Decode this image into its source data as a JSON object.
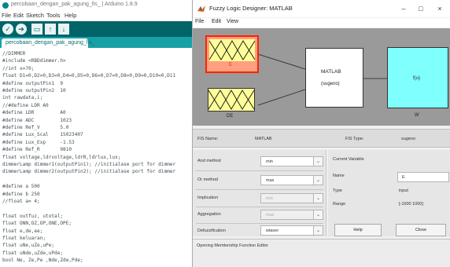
{
  "arduino": {
    "title": "percobaan_dengan_pak_agung_fis_ | Arduino 1.8.9",
    "menu": [
      "File",
      "Edit",
      "Sketch",
      "Tools",
      "Help"
    ],
    "tab": "percobaan_dengan_pak_agung_fis_",
    "code": [
      "//DIMMER",
      "#include <RBDdimmer.h>",
      "//int x=70;",
      "float D1=0,D2=0,D3=0,D4=0,D5=0,D6=0,D7=0,D8=0,D9=0,D10=0,D11",
      "#define outputPin1  9",
      "#define outputPin2  10",
      "int rawdata,i;",
      "//#define LDR A0",
      "#define LDR         A0",
      "#define ADC         1023",
      "#define Ref_V       5.0",
      "#define Lux_Scal    15023407",
      "#define Lux_Exp     -1.53",
      "#define Ref_R       9810",
      "float voltage,ldrvoltage,ldrR,ldrlux,lux;",
      "dimmerLamp dimmer1(outputPin1); //initialase port for dimmer",
      "dimmerLamp dimmer2(outputPin2); //initialase port for dimmer",
      "",
      "#define a 500",
      "#define b 250",
      "//float a= 4;",
      "",
      "float outfuz, utotal;",
      "float ONN,OZ,OP,ONE,OPE;",
      "float e,de,ee;",
      "float keluaran;",
      "float uNe,uZe,uPe;",
      "float uNde,uZde,uPde;",
      "bool Ne, Ze,Pe ,Nde,Zde,Pde;"
    ]
  },
  "fuzzy": {
    "title": "Fuzzy Logic Designer: MATLAB",
    "menu": [
      "File",
      "Edit",
      "View"
    ],
    "window_controls": [
      "–",
      "□",
      "×"
    ],
    "diagram": {
      "input1": "E",
      "input2": "DE",
      "system_name": "MATLAB",
      "system_type": "(sugeno)",
      "output_inner": "f(u)",
      "output": "W"
    },
    "fis_name_label": "FIS Name:",
    "fis_name_value": "MATLAB",
    "fis_type_label": "FIS Type:",
    "fis_type_value": "sugeno",
    "methods": {
      "and_label": "And method",
      "and_value": "min",
      "or_label": "Or method",
      "or_value": "max",
      "impl_label": "Implication",
      "impl_value": "min",
      "agg_label": "Aggregation",
      "agg_value": "max",
      "defuzz_label": "Defuzzification",
      "defuzz_value": "wtaver"
    },
    "current_variable": {
      "heading": "Current Variable",
      "name_label": "Name",
      "name_value": "E",
      "type_label": "Type",
      "type_value": "input",
      "range_label": "Range",
      "range_value": "[-1000 1000]"
    },
    "help_button": "Help",
    "close_button": "Close",
    "status": "Opening Membership Function Editor",
    "colors": {
      "input_fill": "#ffff99",
      "selected_border": "#ff2200",
      "selected_bg": "#ff9f80",
      "output_fill": "#80ffff",
      "arduino_teal": "#006468"
    }
  }
}
